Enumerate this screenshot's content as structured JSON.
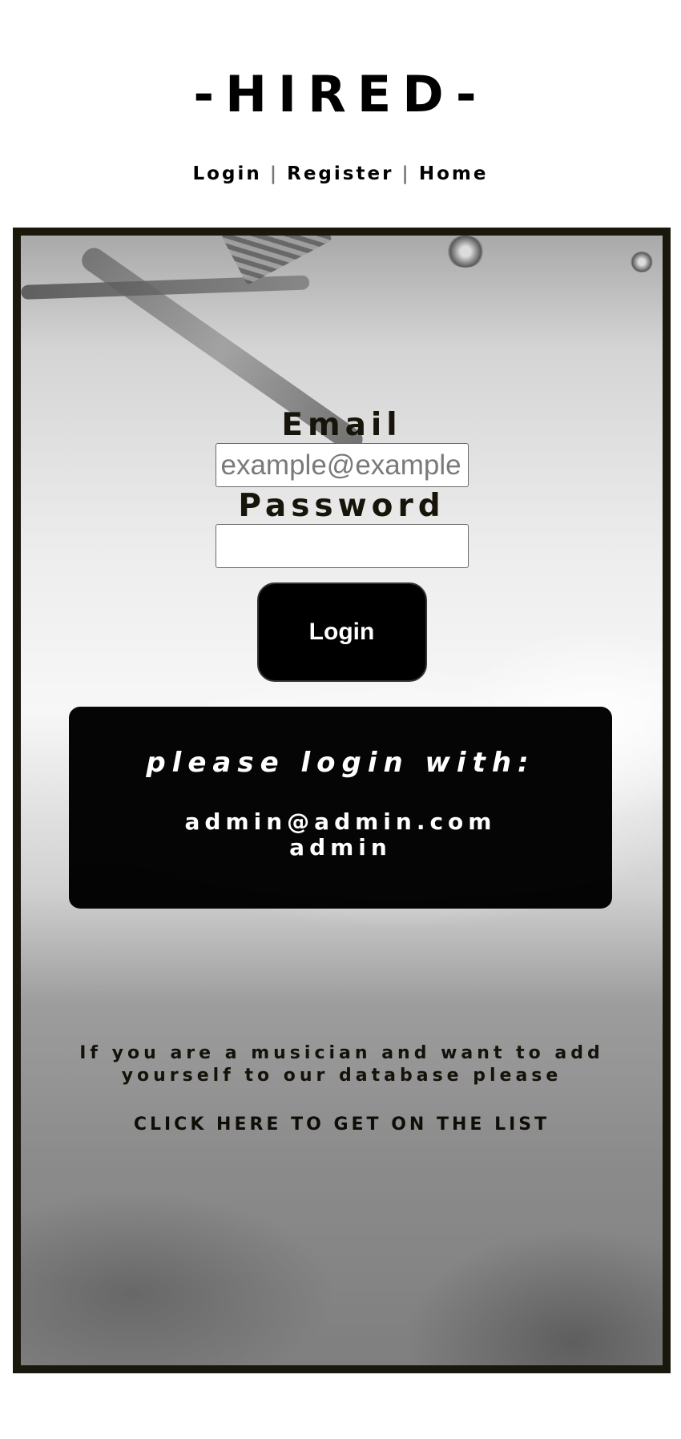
{
  "logo": "-HIRED-",
  "nav": {
    "login": "Login",
    "register": "Register",
    "home": "Home",
    "separator": "|"
  },
  "form": {
    "email_label": "Email",
    "email_placeholder": "example@example.com",
    "password_label": "Password",
    "password_value": "",
    "login_button": "Login"
  },
  "info": {
    "heading": "please login with:",
    "email": "admin@admin.com",
    "password": "admin"
  },
  "musician_text": "If you are a musician and want to add yourself to our database please",
  "list_link": "CLICK HERE TO GET ON THE LIST",
  "colors": {
    "frame_border": "#1a170c",
    "button_bg": "#000000",
    "text_dark": "#17140a"
  }
}
